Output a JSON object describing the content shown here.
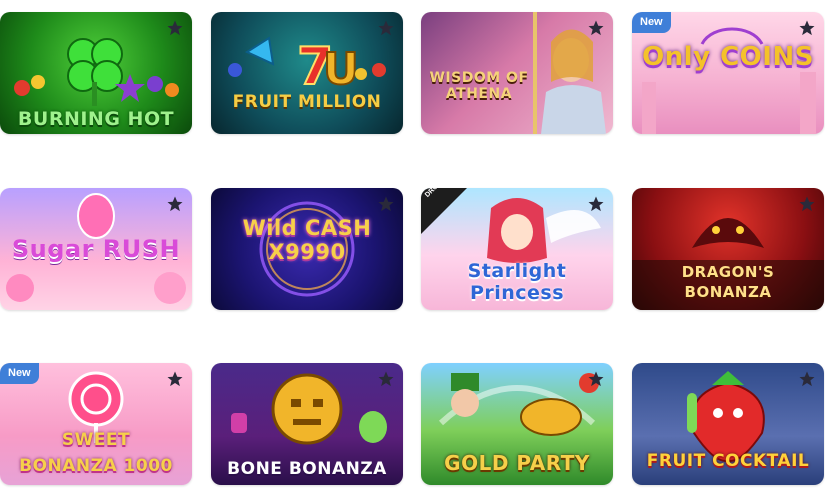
{
  "games": [
    {
      "title": "BURNING HOT",
      "badge": "",
      "icon": "star-icon"
    },
    {
      "title": "FRUIT MILLION",
      "badge": "",
      "icon": "star-icon"
    },
    {
      "title": "WISDOM OF ATHENA",
      "badge": "",
      "icon": "star-icon"
    },
    {
      "title": "Only COINS",
      "badge": "New",
      "icon": "star-icon"
    },
    {
      "title": "Sugar RUSH",
      "badge": "",
      "icon": "star-icon"
    },
    {
      "title": "Wild CASH X9990",
      "badge": "",
      "icon": "star-icon"
    },
    {
      "title": "Starlight Princess",
      "badge": "DROPS & WINS",
      "icon": "star-icon"
    },
    {
      "title": "DRAGON'S BONANZA",
      "badge": "",
      "icon": "star-icon"
    },
    {
      "title": "SWEET BONANZA 1000",
      "badge": "New",
      "icon": "star-icon"
    },
    {
      "title": "BONE BONANZA",
      "badge": "",
      "icon": "star-icon"
    },
    {
      "title": "GOLD PARTY",
      "badge": "",
      "icon": "star-icon"
    },
    {
      "title": "FRUIT COCKTAIL",
      "badge": "",
      "icon": "star-icon"
    }
  ],
  "colors": {
    "new_badge": "#3f7fd8",
    "favorite_star": "#2a2a3a"
  }
}
